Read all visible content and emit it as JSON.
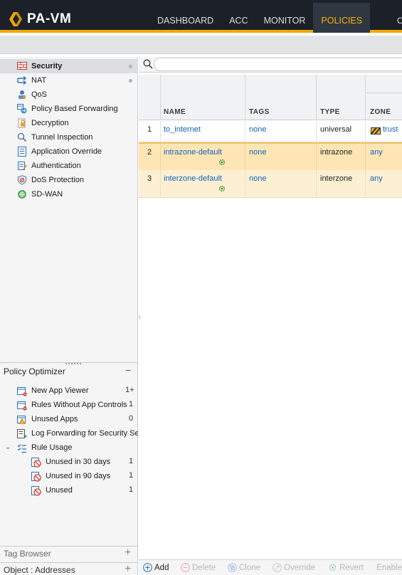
{
  "app": {
    "logo_text": "PA-VM",
    "nav_tabs": [
      {
        "label": "DASHBOARD",
        "active": false
      },
      {
        "label": "ACC",
        "active": false
      },
      {
        "label": "MONITOR",
        "active": false
      },
      {
        "label": "POLICIES",
        "active": true
      }
    ],
    "nav_overflow": "C",
    "accent_color": "#f0a800"
  },
  "sidebar": {
    "items": [
      {
        "label": "Security",
        "icon": "security-rule-icon",
        "selected": true,
        "dot": true
      },
      {
        "label": "NAT",
        "icon": "nat-icon",
        "selected": false,
        "dot": true
      },
      {
        "label": "QoS",
        "icon": "qos-icon",
        "selected": false,
        "dot": false
      },
      {
        "label": "Policy Based Forwarding",
        "icon": "pbf-icon",
        "selected": false,
        "dot": false
      },
      {
        "label": "Decryption",
        "icon": "lock-icon",
        "selected": false,
        "dot": false
      },
      {
        "label": "Tunnel Inspection",
        "icon": "tunnel-icon",
        "selected": false,
        "dot": false
      },
      {
        "label": "Application Override",
        "icon": "app-override-icon",
        "selected": false,
        "dot": false
      },
      {
        "label": "Authentication",
        "icon": "authentication-icon",
        "selected": false,
        "dot": false
      },
      {
        "label": "DoS Protection",
        "icon": "shield-icon",
        "selected": false,
        "dot": false
      },
      {
        "label": "SD-WAN",
        "icon": "sdwan-icon",
        "selected": false,
        "dot": false
      }
    ]
  },
  "optimizer": {
    "title": "Policy Optimizer",
    "collapse_glyph": "−",
    "items": [
      {
        "label": "New App Viewer",
        "count": "1+"
      },
      {
        "label": "Rules Without App Controls",
        "count": "1"
      },
      {
        "label": "Unused Apps",
        "count": "0"
      },
      {
        "label": "Log Forwarding for Security Services",
        "count": ""
      },
      {
        "label": "Rule Usage",
        "count": ""
      },
      {
        "label": "Unused in 30 days",
        "count": "1"
      },
      {
        "label": "Unused in 90 days",
        "count": "1"
      },
      {
        "label": "Unused",
        "count": "1"
      }
    ]
  },
  "bottom_sections": [
    {
      "label": "Tag Browser",
      "action": "+"
    },
    {
      "label": "Object : Addresses",
      "action": "+"
    }
  ],
  "search": {
    "placeholder": "",
    "value": ""
  },
  "table": {
    "columns": [
      "NAME",
      "TAGS",
      "TYPE",
      "ZONE"
    ],
    "rows": [
      {
        "num": "1",
        "name": "to_internet",
        "tags": "none",
        "type": "universal",
        "zone": "trust",
        "default": false
      },
      {
        "num": "2",
        "name": "intrazone-default",
        "tags": "none",
        "type": "intrazone",
        "zone": "any",
        "default": true
      },
      {
        "num": "3",
        "name": "interzone-default",
        "tags": "none",
        "type": "interzone",
        "zone": "any",
        "default": true
      }
    ]
  },
  "footer": {
    "buttons": [
      {
        "label": "Add",
        "enabled": true
      },
      {
        "label": "Delete",
        "enabled": false
      },
      {
        "label": "Clone",
        "enabled": false
      },
      {
        "label": "Override",
        "enabled": false
      },
      {
        "label": "Revert",
        "enabled": false
      },
      {
        "label": "Enable",
        "enabled": false
      }
    ]
  }
}
